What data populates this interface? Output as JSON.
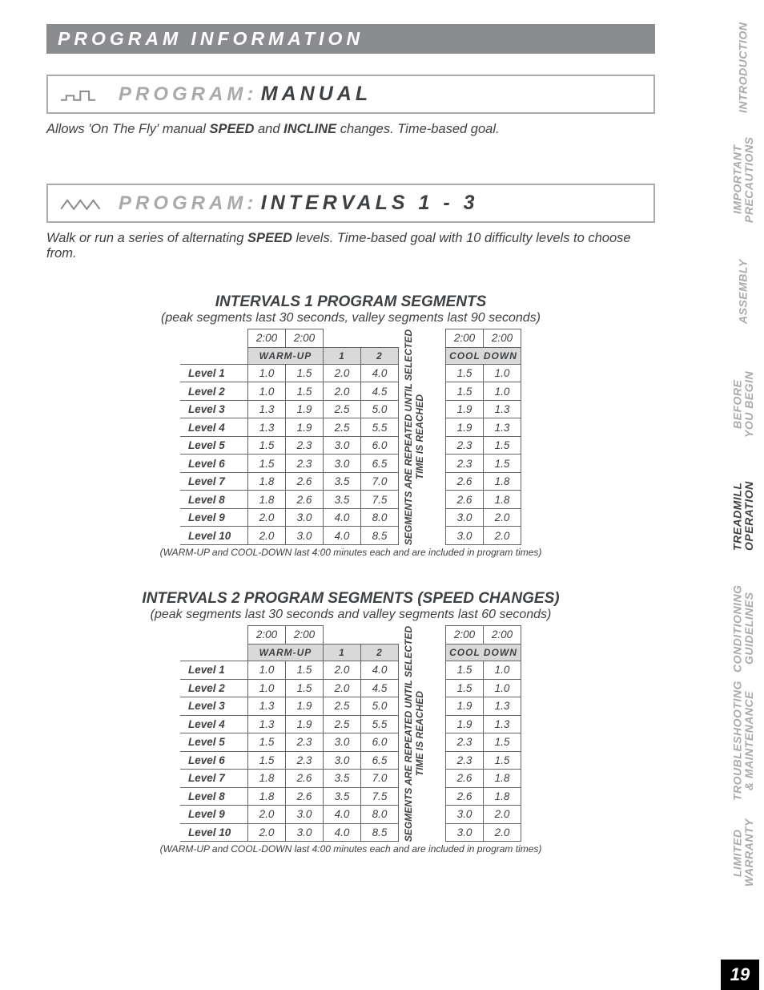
{
  "section_bar": "PROGRAM INFORMATION",
  "program_prefix": "PROGRAM:",
  "programs": {
    "manual": {
      "name": "MANUAL",
      "desc_parts": [
        "Allows 'On The Fly' manual ",
        "SPEED",
        " and ",
        "INCLINE",
        " changes. Time-based goal."
      ]
    },
    "intervals": {
      "name": "INTERVALS 1 - 3",
      "desc_parts": [
        "Walk or run a series of alternating ",
        "SPEED",
        " levels. Time-based goal with 10 difficulty levels to choose from."
      ]
    }
  },
  "warmup_label": "WARM-UP",
  "cooldown_label": "COOL DOWN",
  "seg_headers": [
    "1",
    "2"
  ],
  "time_cell": "2:00",
  "vertical_note": [
    "SEGMENTS ARE REPEATED UNTIL SELECTED",
    "TIME IS REACHED"
  ],
  "footnote": "(WARM-UP and COOL-DOWN last 4:00 minutes each and are included in program times)",
  "table1": {
    "title": "INTERVALS 1 PROGRAM SEGMENTS",
    "subtitle": "(peak segments last 30 seconds, valley segments last 90 seconds)"
  },
  "table2": {
    "title": "INTERVALS 2 PROGRAM SEGMENTS (SPEED CHANGES)",
    "subtitle": "(peak segments last 30 seconds and valley segments last 60 seconds)"
  },
  "levels": [
    {
      "label": "Level 1",
      "w": [
        "1.0",
        "1.5"
      ],
      "s": [
        "2.0",
        "4.0"
      ],
      "c": [
        "1.5",
        "1.0"
      ]
    },
    {
      "label": "Level 2",
      "w": [
        "1.0",
        "1.5"
      ],
      "s": [
        "2.0",
        "4.5"
      ],
      "c": [
        "1.5",
        "1.0"
      ]
    },
    {
      "label": "Level 3",
      "w": [
        "1.3",
        "1.9"
      ],
      "s": [
        "2.5",
        "5.0"
      ],
      "c": [
        "1.9",
        "1.3"
      ]
    },
    {
      "label": "Level 4",
      "w": [
        "1.3",
        "1.9"
      ],
      "s": [
        "2.5",
        "5.5"
      ],
      "c": [
        "1.9",
        "1.3"
      ]
    },
    {
      "label": "Level 5",
      "w": [
        "1.5",
        "2.3"
      ],
      "s": [
        "3.0",
        "6.0"
      ],
      "c": [
        "2.3",
        "1.5"
      ]
    },
    {
      "label": "Level 6",
      "w": [
        "1.5",
        "2.3"
      ],
      "s": [
        "3.0",
        "6.5"
      ],
      "c": [
        "2.3",
        "1.5"
      ]
    },
    {
      "label": "Level 7",
      "w": [
        "1.8",
        "2.6"
      ],
      "s": [
        "3.5",
        "7.0"
      ],
      "c": [
        "2.6",
        "1.8"
      ]
    },
    {
      "label": "Level 8",
      "w": [
        "1.8",
        "2.6"
      ],
      "s": [
        "3.5",
        "7.5"
      ],
      "c": [
        "2.6",
        "1.8"
      ]
    },
    {
      "label": "Level 9",
      "w": [
        "2.0",
        "3.0"
      ],
      "s": [
        "4.0",
        "8.0"
      ],
      "c": [
        "3.0",
        "2.0"
      ]
    },
    {
      "label": "Level 10",
      "w": [
        "2.0",
        "3.0"
      ],
      "s": [
        "4.0",
        "8.5"
      ],
      "c": [
        "3.0",
        "2.0"
      ]
    }
  ],
  "sidetabs": [
    {
      "label": "INTRODUCTION"
    },
    {
      "label": "IMPORTANT\nPRECAUTIONS"
    },
    {
      "label": "ASSEMBLY"
    },
    {
      "label": "BEFORE\nYOU BEGIN"
    },
    {
      "label": "TREADMILL\nOPERATION",
      "active": true
    },
    {
      "label": "CONDITIONING\nGUIDELINES"
    },
    {
      "label": "TROUBLESHOOTING\n& MAINTENANCE"
    },
    {
      "label": "LIMITED\nWARRANTY"
    }
  ],
  "page_number": "19"
}
